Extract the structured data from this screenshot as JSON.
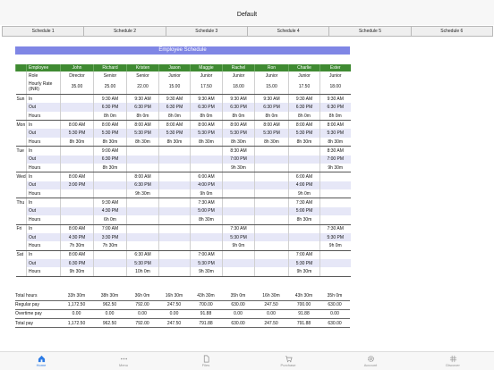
{
  "nav": {
    "title": "Default"
  },
  "tabs": [
    "Schedule 1",
    "Schedule 2",
    "Schedule 3",
    "Schedule 4",
    "Schedule 5",
    "Schedule 6"
  ],
  "schedule_title": "Employee Schedule",
  "header": {
    "employee": "Employee",
    "role": "Role",
    "rate": "Hourly Rate (INR)"
  },
  "employees": [
    {
      "name": "John",
      "role": "Director",
      "rate": "35.00"
    },
    {
      "name": "Richard",
      "role": "Senior",
      "rate": "25.00"
    },
    {
      "name": "Kristen",
      "role": "Senior",
      "rate": "22.00"
    },
    {
      "name": "Jason",
      "role": "Junior",
      "rate": "15.00"
    },
    {
      "name": "Maggie",
      "role": "Junior",
      "rate": "17.50"
    },
    {
      "name": "Rachel",
      "role": "Junior",
      "rate": "18.00"
    },
    {
      "name": "Ron",
      "role": "Junior",
      "rate": "15.00"
    },
    {
      "name": "Charlie",
      "role": "Junior",
      "rate": "17.50"
    },
    {
      "name": "Ester",
      "role": "Junior",
      "rate": "18.00"
    }
  ],
  "row_labels": {
    "in": "In",
    "out": "Out",
    "hours": "Hours"
  },
  "days": [
    {
      "name": "Sun",
      "in": [
        "",
        "9:30 AM",
        "9:30 AM",
        "9:30 AM",
        "9:30 AM",
        "9:30 AM",
        "9:30 AM",
        "9:30 AM",
        "9:30 AM"
      ],
      "out": [
        "",
        "6:30 PM",
        "6:30 PM",
        "6:30 PM",
        "6:30 PM",
        "6:30 PM",
        "6:30 PM",
        "6:30 PM",
        "6:30 PM"
      ],
      "hours": [
        "",
        "8h 0m",
        "8h 0m",
        "8h 0m",
        "8h 0m",
        "8h 0m",
        "8h 0m",
        "8h 0m",
        "8h 0m"
      ]
    },
    {
      "name": "Mon",
      "in": [
        "8:00 AM",
        "8:00 AM",
        "8:00 AM",
        "8:00 AM",
        "8:00 AM",
        "8:00 AM",
        "8:00 AM",
        "8:00 AM",
        "8:00 AM"
      ],
      "out": [
        "5:30 PM",
        "5:30 PM",
        "5:30 PM",
        "5:30 PM",
        "5:30 PM",
        "5:30 PM",
        "5:30 PM",
        "5:30 PM",
        "5:30 PM"
      ],
      "hours": [
        "8h 30m",
        "8h 30m",
        "8h 30m",
        "8h 30m",
        "8h 30m",
        "8h 30m",
        "8h 30m",
        "8h 30m",
        "8h 30m"
      ]
    },
    {
      "name": "Tue",
      "in": [
        "",
        "9:00 AM",
        "",
        "",
        "",
        "8:30 AM",
        "",
        "",
        "8:30 AM"
      ],
      "out": [
        "",
        "6:30 PM",
        "",
        "",
        "",
        "7:00 PM",
        "",
        "",
        "7:00 PM"
      ],
      "hours": [
        "",
        "8h 30m",
        "",
        "",
        "",
        "9h 30m",
        "",
        "",
        "9h 30m"
      ]
    },
    {
      "name": "Wed",
      "in": [
        "8:00 AM",
        "",
        "8:00 AM",
        "",
        "6:00 AM",
        "",
        "",
        "6:00 AM",
        ""
      ],
      "out": [
        "3:00 PM",
        "",
        "6:30 PM",
        "",
        "4:00 PM",
        "",
        "",
        "4:00 PM",
        ""
      ],
      "hours": [
        "",
        "",
        "9h 30m",
        "",
        "9h 0m",
        "",
        "",
        "9h 0m",
        ""
      ]
    },
    {
      "name": "Thu",
      "in": [
        "",
        "9:30 AM",
        "",
        "",
        "7:30 AM",
        "",
        "",
        "7:30 AM",
        ""
      ],
      "out": [
        "",
        "4:30 PM",
        "",
        "",
        "5:00 PM",
        "",
        "",
        "5:00 PM",
        ""
      ],
      "hours": [
        "",
        "6h 0m",
        "",
        "",
        "8h 30m",
        "",
        "",
        "8h 30m",
        ""
      ]
    },
    {
      "name": "Fri",
      "in": [
        "8:00 AM",
        "7:00 AM",
        "",
        "",
        "",
        "7:30 AM",
        "",
        "",
        "7:30 AM"
      ],
      "out": [
        "4:30 PM",
        "3:30 PM",
        "",
        "",
        "",
        "5:30 PM",
        "",
        "",
        "5:30 PM"
      ],
      "hours": [
        "7h 30m",
        "7h 30m",
        "",
        "",
        "",
        "9h 0m",
        "",
        "",
        "9h 0m"
      ]
    },
    {
      "name": "Sat",
      "in": [
        "8:00 AM",
        "",
        "6:30 AM",
        "",
        "7:00 AM",
        "",
        "",
        "7:00 AM",
        ""
      ],
      "out": [
        "6:30 PM",
        "",
        "5:30 PM",
        "",
        "5:30 PM",
        "",
        "",
        "5:30 PM",
        ""
      ],
      "hours": [
        "9h 30m",
        "",
        "10h 0m",
        "",
        "9h 30m",
        "",
        "",
        "9h 30m",
        ""
      ]
    }
  ],
  "totals": [
    {
      "label": "Total hours",
      "values": [
        "33h 30m",
        "38h 30m",
        "36h 0m",
        "16h 30m",
        "43h 30m",
        "35h 0m",
        "16h 30m",
        "43h 30m",
        "35h 0m"
      ]
    },
    {
      "label": "Regular pay",
      "values": [
        "1,172.50",
        "962.50",
        "792.00",
        "247.50",
        "700.00",
        "630.00",
        "247.50",
        "700.00",
        "630.00"
      ]
    },
    {
      "label": "Overtime pay",
      "values": [
        "0.00",
        "0.00",
        "0.00",
        "0.00",
        "91.88",
        "0.00",
        "0.00",
        "91.88",
        "0.00"
      ]
    },
    {
      "label": "Total pay",
      "values": [
        "1,172.50",
        "962.50",
        "792.00",
        "247.50",
        "791.88",
        "630.00",
        "247.50",
        "791.88",
        "630.00"
      ]
    }
  ],
  "tabbar": [
    {
      "label": "Home",
      "icon": "home-icon",
      "active": true
    },
    {
      "label": "Menu",
      "icon": "dots-icon",
      "active": false
    },
    {
      "label": "Files",
      "icon": "file-icon",
      "active": false
    },
    {
      "label": "Purchase",
      "icon": "cart-icon",
      "active": false
    },
    {
      "label": "Account",
      "icon": "gear-icon",
      "active": false
    },
    {
      "label": "Discover",
      "icon": "hash-icon",
      "active": false
    }
  ],
  "colors": {
    "header_green": "#3f8a32",
    "title_blue": "#7f86e5",
    "accent": "#2c7be5",
    "shade": "#e6e7f7"
  }
}
